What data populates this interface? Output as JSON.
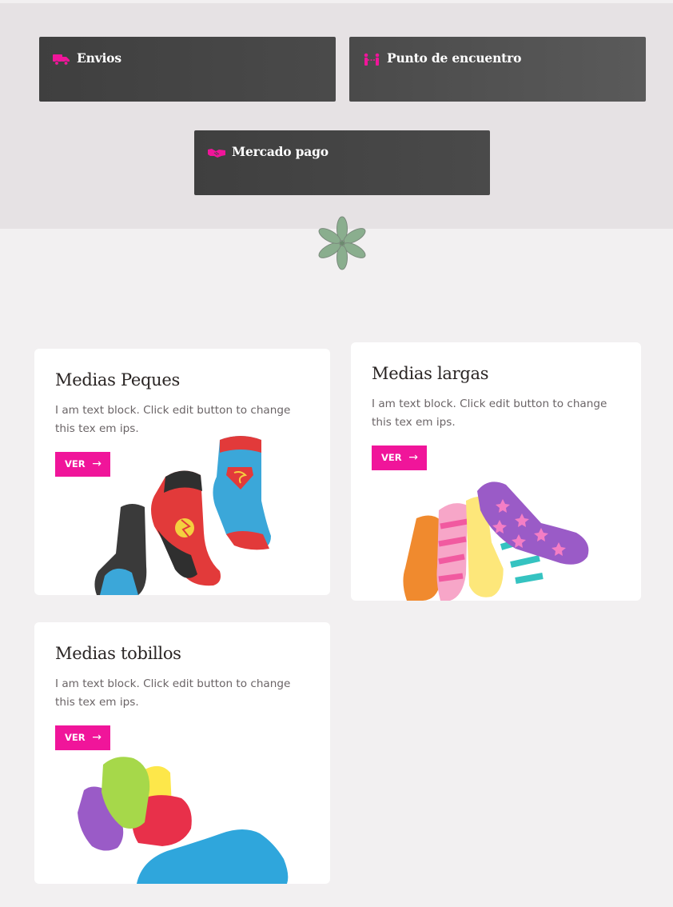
{
  "services": [
    {
      "label": "Envios",
      "icon": "truck-icon"
    },
    {
      "label": "Punto de encuentro",
      "icon": "people-meeting-icon"
    },
    {
      "label": "Mercado pago",
      "icon": "handshake-icon"
    }
  ],
  "colors": {
    "accent": "#f0159a",
    "service_bg": "#444444",
    "band_bg": "#e6e2e4",
    "page_bg": "#f2f0f1",
    "flower": "#8aae8e"
  },
  "products": [
    {
      "title": "Medias Peques",
      "description": "I am text block. Click edit button to change this tex em ips.",
      "button": "VER",
      "image": "kids-character-socks"
    },
    {
      "title": "Medias largas",
      "description": "I am text block. Click edit button to change this tex em ips.",
      "button": "VER",
      "image": "colorful-long-socks"
    },
    {
      "title": "Medias tobillos",
      "description": "I am text block. Click edit button to change this tex em ips.",
      "button": "VER",
      "image": "ankle-socks"
    }
  ]
}
